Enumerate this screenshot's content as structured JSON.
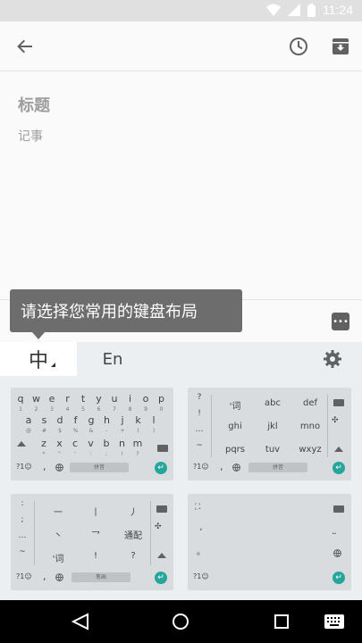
{
  "status_bar": {
    "time": "11:24",
    "icons": [
      "wifi-icon",
      "signal-icon",
      "battery-icon"
    ]
  },
  "app_bar": {
    "icons": [
      "back-arrow-icon",
      "reminder-clock-icon",
      "archive-icon"
    ]
  },
  "note": {
    "title_placeholder": "标题",
    "body_placeholder": "记事"
  },
  "tooltip": {
    "text": "请选择您常用的键盘布局"
  },
  "ime": {
    "tab_chinese": "中",
    "tab_english": "En",
    "qwerty": {
      "row1": [
        "q",
        "w",
        "e",
        "r",
        "t",
        "y",
        "u",
        "i",
        "o",
        "p"
      ],
      "row1_sub": [
        "1",
        "2",
        "3",
        "4",
        "5",
        "6",
        "7",
        "8",
        "9",
        "0"
      ],
      "row2": [
        "a",
        "s",
        "d",
        "f",
        "g",
        "h",
        "j",
        "k",
        "l"
      ],
      "row2_sub": [
        "@",
        "#",
        "$",
        "%",
        "&",
        "-",
        "+",
        "(",
        ")"
      ],
      "row3": [
        "z",
        "x",
        "c",
        "v",
        "b",
        "n",
        "m"
      ],
      "row3_sub": [
        "*",
        "\"",
        "'",
        ":",
        ";",
        "!",
        "?"
      ],
      "sym": "?1☺",
      "comma": ",",
      "space": "拼音"
    },
    "t9": {
      "left_col": [
        "?",
        "!",
        "…",
        "~"
      ],
      "row1": [
        "'词",
        "abc",
        "def"
      ],
      "row2": [
        "ghi",
        "jkl",
        "mno"
      ],
      "row3": [
        "pqrs",
        "tuv",
        "wxyz"
      ],
      "sym": "?1☺",
      "comma": ",",
      "space": "拼音"
    },
    "stroke": {
      "left_col": [
        ":",
        ";",
        "…",
        "~"
      ],
      "row1": [
        "一",
        "丨",
        "丿"
      ],
      "row2": [
        "丶",
        "乛",
        "通配"
      ],
      "row3": [
        "'词",
        "!",
        "?"
      ],
      "sym": "?1☺",
      "comma": ",",
      "space": "笔画"
    },
    "handwriting": {
      "left_col": [
        ",",
        "。"
      ],
      "sym": "?1☺",
      "comma": ","
    }
  },
  "nav_bar": {
    "icons": [
      "back-triangle-icon",
      "home-circle-icon",
      "recents-square-icon",
      "keyboard-icon"
    ]
  },
  "colors": {
    "enter": "#26a69a",
    "tooltip": "#6d6d6d",
    "status_bar": "#e0e0e0"
  }
}
